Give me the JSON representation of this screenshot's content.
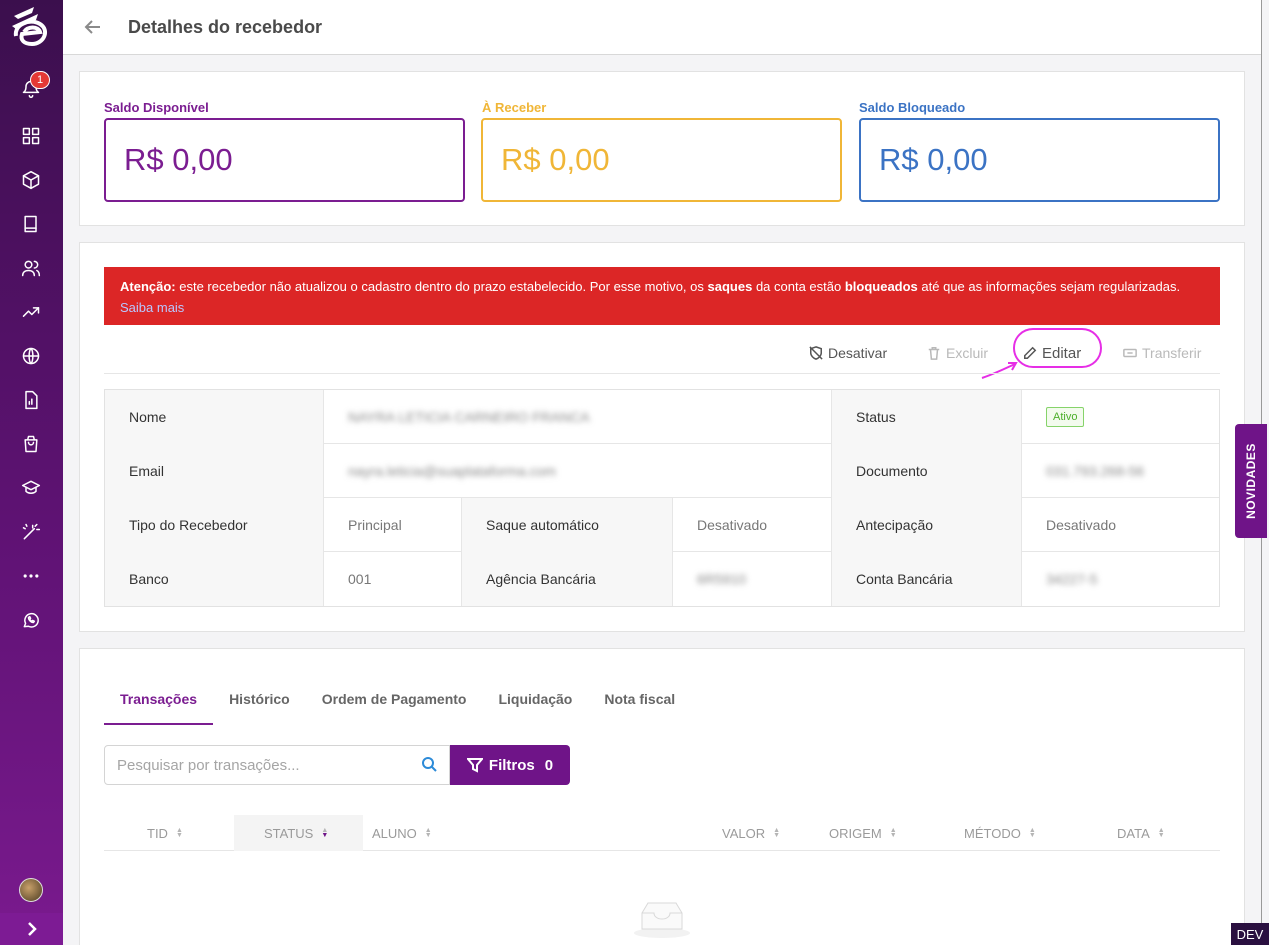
{
  "header": {
    "title": "Detalhes do recebedor"
  },
  "sidebar": {
    "notification_count": "1"
  },
  "balances": [
    {
      "label": "Saldo Disponível",
      "value": "R$ 0,00",
      "color": "#7b1d91"
    },
    {
      "label": "À Receber",
      "value": "R$ 0,00",
      "color": "#f0b637"
    },
    {
      "label": "Saldo Bloqueado",
      "value": "R$ 0,00",
      "color": "#3b73c4"
    }
  ],
  "alert": {
    "prefix": "Atenção:",
    "text1": " este recebedor não atualizou o cadastro dentro do prazo estabelecido. Por esse motivo, os ",
    "bold1": "saques",
    "text2": " da conta estão ",
    "bold2": "bloqueados",
    "text3": " até que as informações sejam regularizadas. ",
    "link": "Saiba mais"
  },
  "actions": {
    "deactivate": "Desativar",
    "delete": "Excluir",
    "edit": "Editar",
    "transfer": "Transferir"
  },
  "details": {
    "name_label": "Nome",
    "name_value": "NAYRA LETICIA CARNEIRO FRANCA",
    "status_label": "Status",
    "status_value": "Ativo",
    "email_label": "Email",
    "email_value": "nayra.leticia@suaplataforma.com",
    "document_label": "Documento",
    "document_value": "031.793.268-56",
    "type_label": "Tipo do Recebedor",
    "type_value": "Principal",
    "autowithdraw_label": "Saque automático",
    "autowithdraw_value": "Desativado",
    "anticipation_label": "Antecipação",
    "anticipation_value": "Desativado",
    "bank_label": "Banco",
    "bank_value": "001",
    "agency_label": "Agência Bancária",
    "agency_value": "6R5910",
    "account_label": "Conta Bancária",
    "account_value": "34227-5"
  },
  "tabs": [
    "Transações",
    "Histórico",
    "Ordem de Pagamento",
    "Liquidação",
    "Nota fiscal"
  ],
  "search": {
    "placeholder": "Pesquisar por transações..."
  },
  "filters": {
    "label": "Filtros",
    "count": "0"
  },
  "table_headers": [
    "TID",
    "STATUS",
    "ALUNO",
    "VALOR",
    "ORIGEM",
    "MÉTODO",
    "DATA"
  ],
  "novidades": "NOVIDADES",
  "env_badge": "DEV"
}
